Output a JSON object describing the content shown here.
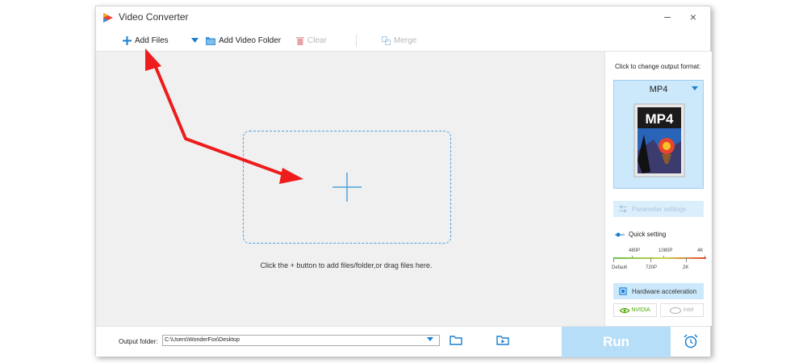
{
  "window": {
    "title": "Video Converter",
    "minimize_glyph": "–",
    "close_glyph": "×"
  },
  "toolbar": {
    "add_files": "Add Files",
    "add_video_folder": "Add Video Folder",
    "clear": "Clear",
    "merge": "Merge"
  },
  "main": {
    "hint": "Click the + button to add files/folder,or drag files here."
  },
  "right_panel": {
    "title": "Click to change output format:",
    "format": "MP4",
    "format_icon_text": "MP4",
    "parameter_settings": "Parameter settings",
    "quick_setting": "Quick setting",
    "quality_top": [
      "480P",
      "1080P",
      "4K"
    ],
    "quality_bottom": [
      "Default",
      "720P",
      "2K"
    ],
    "hardware_acceleration": "Hardware acceleration",
    "nvidia": "NVIDIA",
    "intel": "Intel"
  },
  "bottom": {
    "output_folder_label": "Output folder:",
    "output_folder_value": "C:\\Users\\WonderFox\\Desktop",
    "run": "Run"
  },
  "icons": {
    "logo": "video-converter-logo-icon",
    "add": "plus-icon",
    "dropdown": "chevron-down-icon",
    "folder": "folder-icon",
    "clear": "trash-icon",
    "merge": "merge-icon",
    "parameter": "sliders-icon",
    "quick": "slider-icon",
    "hardware": "chip-icon",
    "open_folder": "open-folder-icon",
    "video_folder": "video-folder-icon",
    "alarm": "alarm-clock-icon"
  },
  "colors": {
    "accent": "#1a7fd0",
    "annotation_arrow": "#ee1c1c",
    "run_button": "#b6def8",
    "nvidia": "#4ca700"
  }
}
